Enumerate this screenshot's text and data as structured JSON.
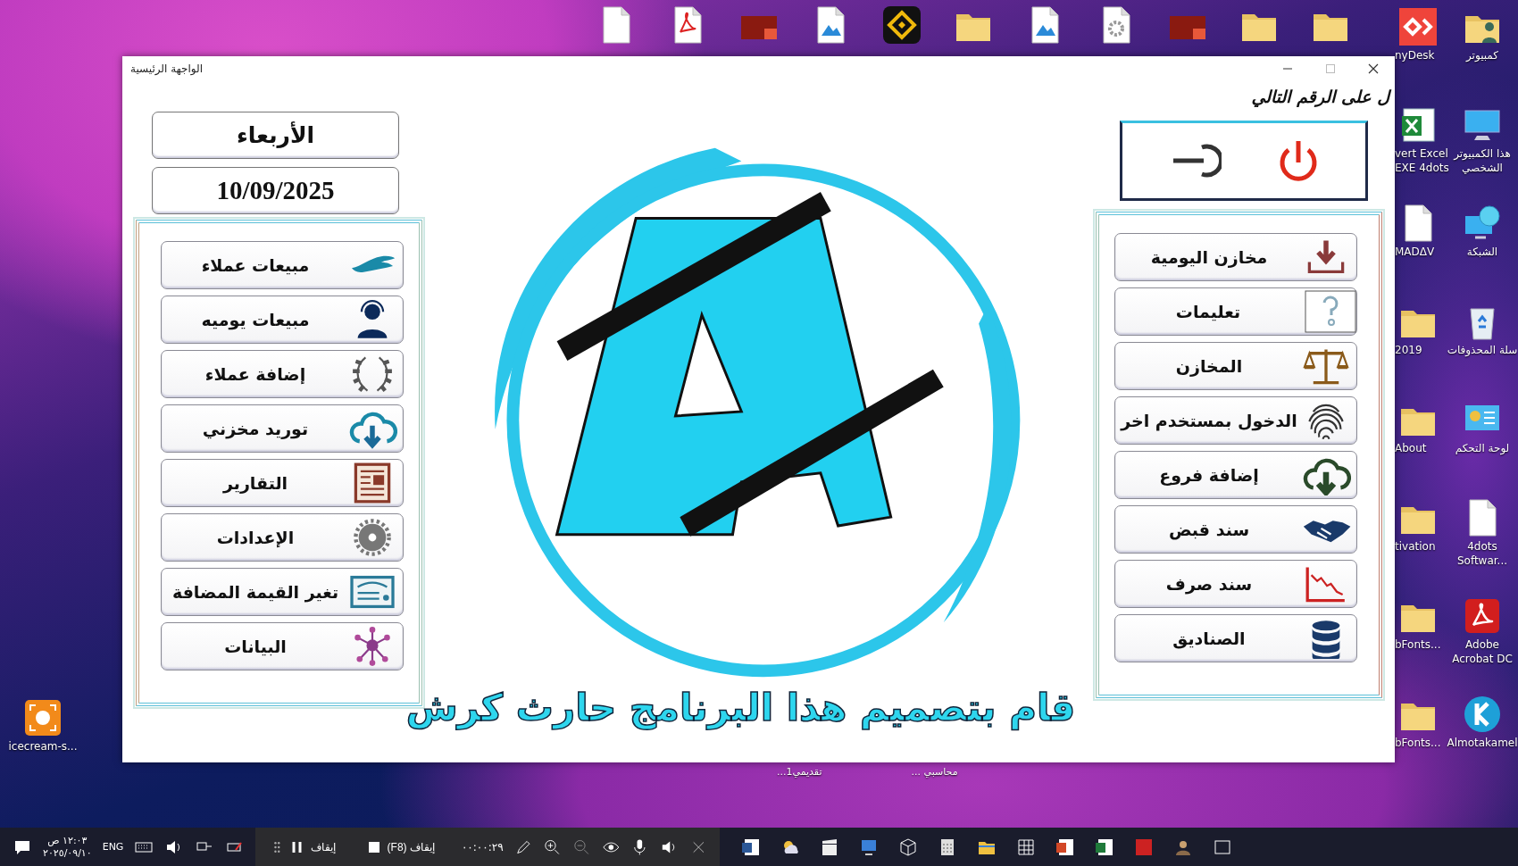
{
  "window": {
    "title": "الواجهة الرئيسية"
  },
  "left_panel": {
    "day": "الأربعاء",
    "date": "10/09/2025",
    "buttons": [
      {
        "label": "مبيعات عملاء"
      },
      {
        "label": "مبيعات يوميه"
      },
      {
        "label": "إضافة عملاء"
      },
      {
        "label": "توريد مخزني"
      },
      {
        "label": "التقارير"
      },
      {
        "label": "الإعدادات"
      },
      {
        "label": "تغير القيمة المضافة"
      },
      {
        "label": "البيانات"
      }
    ]
  },
  "right_panel": {
    "header": "ل على الرقم التالي",
    "buttons": [
      {
        "label": "مخازن اليومية"
      },
      {
        "label": "تعليمات"
      },
      {
        "label": "المخازن"
      },
      {
        "label": "الدخول بمستخدم اخر"
      },
      {
        "label": "إضافة فروع"
      },
      {
        "label": "سند قبض"
      },
      {
        "label": "سند صرف"
      },
      {
        "label": "الصناديق"
      }
    ]
  },
  "credit": "قام بتصميم هذا البرنامج حارث كرش",
  "desktop": {
    "partial_icons": [
      {
        "label": "nyDesk"
      },
      {
        "label": "vert Excel EXE 4dots"
      },
      {
        "label": "MADΔV"
      },
      {
        "label": "2019"
      },
      {
        "label": "About"
      },
      {
        "label": "tivation"
      },
      {
        "label": "bFonts..."
      },
      {
        "label": "bFonts..."
      }
    ],
    "right_icons": [
      {
        "label": "كمبيوتر"
      },
      {
        "label": "هذا الكمبيوتر الشخصي"
      },
      {
        "label": "الشبكة"
      },
      {
        "label": "سلة المحذوفات"
      },
      {
        "label": "لوحة التحكم"
      },
      {
        "label": "4dots Softwar..."
      },
      {
        "label": "Adobe Acrobat DC"
      },
      {
        "label": "Almotakamel"
      }
    ],
    "left_icons": [
      {
        "label": "icecream-s..."
      }
    ],
    "bottom_labels": [
      "محاسبي ...",
      "تقديمي1..."
    ]
  },
  "taskbar": {
    "time": "١٢:٠٣ ص",
    "date": "٢٠٢٥/٠٩/١٠",
    "language": "ENG",
    "recorder": {
      "pause": "إيقاف",
      "stop": "إيقاف (F8)",
      "timer": "٠٠:٠٠:٢٩"
    }
  }
}
